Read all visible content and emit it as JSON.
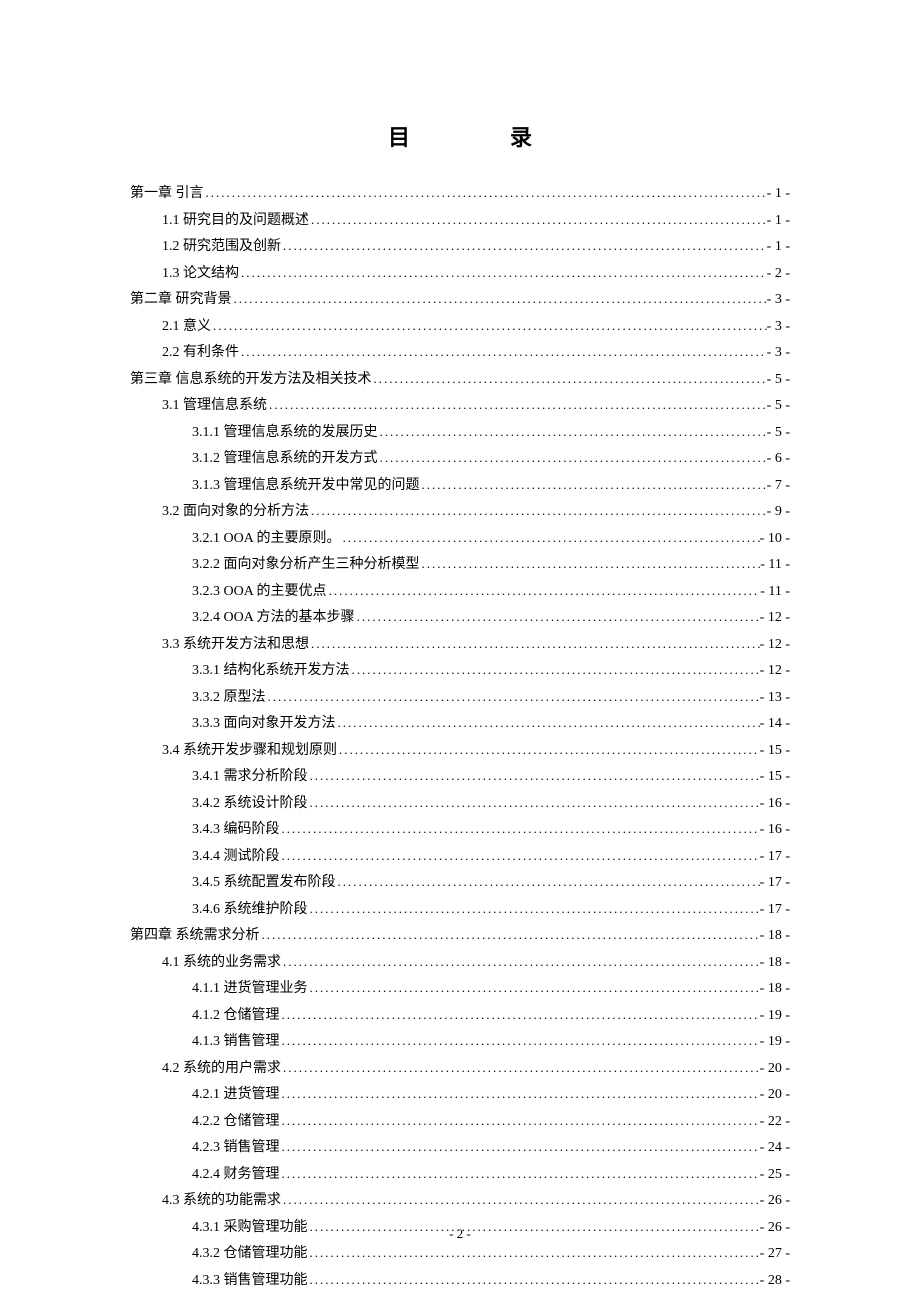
{
  "title": "目录",
  "page_number": "- 2 -",
  "entries": [
    {
      "level": 0,
      "label": "第一章 引言",
      "page": "- 1 -"
    },
    {
      "level": 1,
      "label": "1.1 研究目的及问题概述",
      "page": "- 1 -"
    },
    {
      "level": 1,
      "label": "1.2 研究范围及创新",
      "page": "- 1 -"
    },
    {
      "level": 1,
      "label": "1.3 论文结构",
      "page": "- 2 -"
    },
    {
      "level": 0,
      "label": "第二章 研究背景",
      "page": "- 3 -"
    },
    {
      "level": 1,
      "label": "2.1 意义",
      "page": "- 3 -"
    },
    {
      "level": 1,
      "label": "2.2 有利条件",
      "page": "- 3 -"
    },
    {
      "level": 0,
      "label": "第三章 信息系统的开发方法及相关技术",
      "page": "- 5 -"
    },
    {
      "level": 1,
      "label": "3.1 管理信息系统",
      "page": "- 5 -"
    },
    {
      "level": 2,
      "label": "3.1.1 管理信息系统的发展历史",
      "page": "- 5 -"
    },
    {
      "level": 2,
      "label": "3.1.2 管理信息系统的开发方式",
      "page": "- 6 -"
    },
    {
      "level": 2,
      "label": "3.1.3 管理信息系统开发中常见的问题",
      "page": "- 7 -"
    },
    {
      "level": 1,
      "label": "3.2 面向对象的分析方法",
      "page": "- 9 -"
    },
    {
      "level": 2,
      "label": "3.2.1 OOA 的主要原则。",
      "page": "- 10 -"
    },
    {
      "level": 2,
      "label": "3.2.2 面向对象分析产生三种分析模型",
      "page": "- 11 -"
    },
    {
      "level": 2,
      "label": "3.2.3 OOA 的主要优点",
      "page": "- 11 -"
    },
    {
      "level": 2,
      "label": "3.2.4 OOA 方法的基本步骤",
      "page": "- 12 -"
    },
    {
      "level": 1,
      "label": "3.3 系统开发方法和思想",
      "page": "- 12 -"
    },
    {
      "level": 2,
      "label": "3.3.1 结构化系统开发方法",
      "page": "- 12 -"
    },
    {
      "level": 2,
      "label": "3.3.2 原型法",
      "page": "- 13 -"
    },
    {
      "level": 2,
      "label": "3.3.3 面向对象开发方法",
      "page": "- 14 -"
    },
    {
      "level": 1,
      "label": "3.4 系统开发步骤和规划原则",
      "page": "- 15 -"
    },
    {
      "level": 2,
      "label": "3.4.1 需求分析阶段",
      "page": "- 15 -"
    },
    {
      "level": 2,
      "label": "3.4.2 系统设计阶段",
      "page": "- 16 -"
    },
    {
      "level": 2,
      "label": "3.4.3 编码阶段",
      "page": "- 16 -"
    },
    {
      "level": 2,
      "label": "3.4.4 测试阶段",
      "page": "- 17 -"
    },
    {
      "level": 2,
      "label": "3.4.5 系统配置发布阶段",
      "page": "- 17 -"
    },
    {
      "level": 2,
      "label": "3.4.6 系统维护阶段",
      "page": "- 17 -"
    },
    {
      "level": 0,
      "label": "第四章 系统需求分析",
      "page": "- 18 -"
    },
    {
      "level": 1,
      "label": "4.1 系统的业务需求",
      "page": "- 18 -"
    },
    {
      "level": 2,
      "label": "4.1.1 进货管理业务",
      "page": "- 18 -"
    },
    {
      "level": 2,
      "label": "4.1.2 仓储管理",
      "page": "- 19 -"
    },
    {
      "level": 2,
      "label": "4.1.3 销售管理",
      "page": "- 19 -"
    },
    {
      "level": 1,
      "label": "4.2 系统的用户需求",
      "page": "- 20 -"
    },
    {
      "level": 2,
      "label": "4.2.1 进货管理",
      "page": "- 20 -"
    },
    {
      "level": 2,
      "label": "4.2.2 仓储管理",
      "page": "- 22 -"
    },
    {
      "level": 2,
      "label": "4.2.3 销售管理",
      "page": "- 24 -"
    },
    {
      "level": 2,
      "label": "4.2.4 财务管理",
      "page": "- 25 -"
    },
    {
      "level": 1,
      "label": "4.3 系统的功能需求",
      "page": "- 26 -"
    },
    {
      "level": 2,
      "label": "4.3.1 采购管理功能",
      "page": "- 26 -"
    },
    {
      "level": 2,
      "label": "4.3.2 仓储管理功能",
      "page": "- 27 -"
    },
    {
      "level": 2,
      "label": "4.3.3 销售管理功能",
      "page": "- 28 -"
    }
  ]
}
